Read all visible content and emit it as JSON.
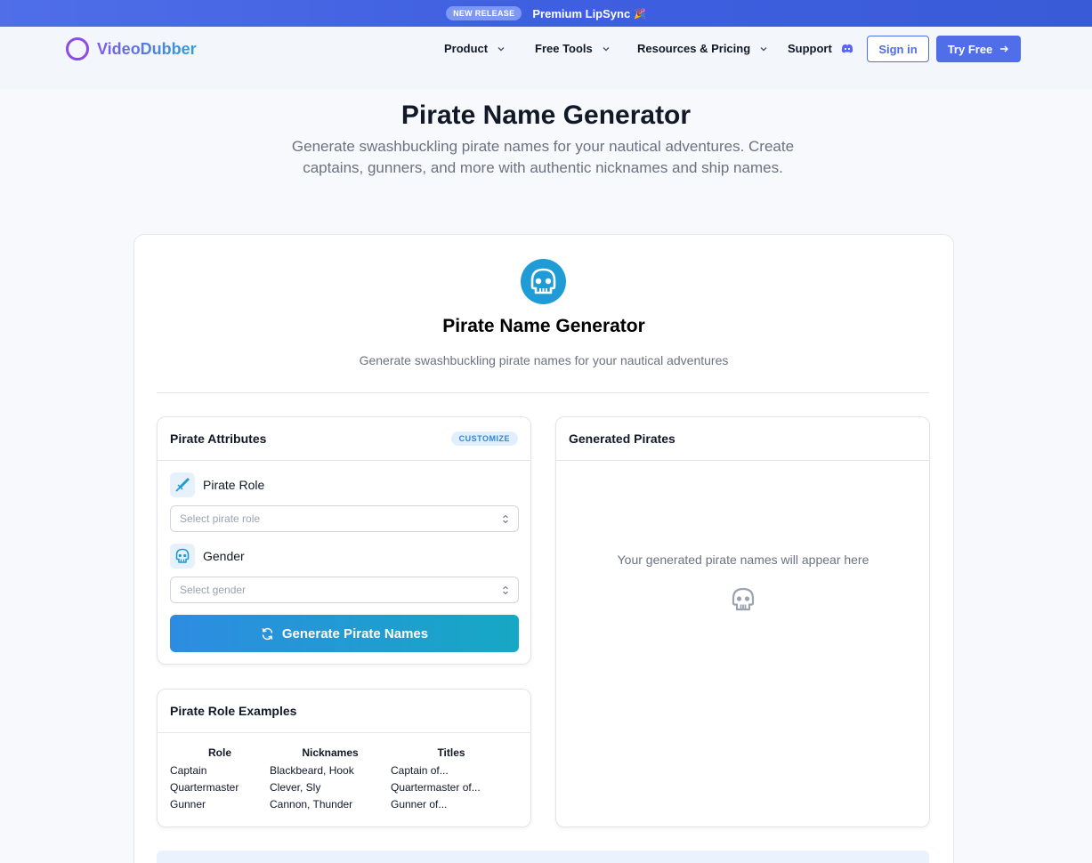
{
  "banner": {
    "badge": "NEW RELEASE",
    "text": "Premium LipSync",
    "emoji": "🎉"
  },
  "nav": {
    "logo": "VideoDubber",
    "items": [
      {
        "label": "Product"
      },
      {
        "label": "Free Tools"
      },
      {
        "label": "Resources & Pricing"
      },
      {
        "label": "Support"
      }
    ],
    "signin": "Sign in",
    "try_free": "Try Free"
  },
  "hero": {
    "title": "Pirate Name Generator",
    "subtitle": "Generate swashbuckling pirate names for your nautical adventures. Create captains, gunners, and more with authentic nicknames and ship names."
  },
  "tool": {
    "title": "Pirate Name Generator",
    "subtitle": "Generate swashbuckling pirate names for your nautical adventures"
  },
  "attributes": {
    "title": "Pirate Attributes",
    "pill": "CUSTOMIZE",
    "role_label": "Pirate Role",
    "role_placeholder": "Select pirate role",
    "gender_label": "Gender",
    "gender_placeholder": "Select gender",
    "generate": "Generate Pirate Names"
  },
  "examples": {
    "title": "Pirate Role Examples",
    "headers": [
      "Role",
      "Nicknames",
      "Titles"
    ],
    "rows": [
      [
        "Captain",
        "Blackbeard, Hook",
        "Captain of..."
      ],
      [
        "Quartermaster",
        "Clever, Sly",
        "Quartermaster of..."
      ],
      [
        "Gunner",
        "Cannon, Thunder",
        "Gunner of..."
      ]
    ]
  },
  "results": {
    "title": "Generated Pirates",
    "empty": "Your generated pirate names will appear here"
  },
  "colors": {
    "primary": "#4f6ee8",
    "accent": "#1f9bd6",
    "logo": "#8b4be8"
  },
  "icons": {
    "skull": "skull-icon",
    "sword": "sword-icon",
    "refresh": "refresh-icon",
    "chevron": "chevron-down-icon",
    "discord": "discord-icon",
    "arrow": "arrow-right-icon"
  }
}
